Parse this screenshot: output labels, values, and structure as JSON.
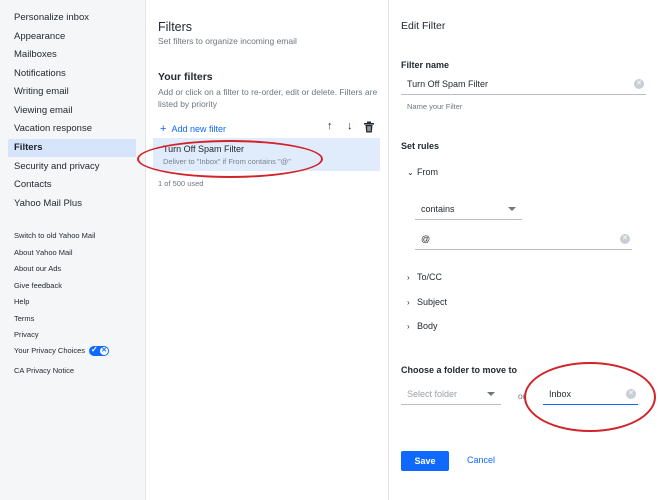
{
  "sidebar": {
    "items": [
      {
        "label": "Personalize inbox"
      },
      {
        "label": "Appearance"
      },
      {
        "label": "Mailboxes"
      },
      {
        "label": "Notifications"
      },
      {
        "label": "Writing email"
      },
      {
        "label": "Viewing email"
      },
      {
        "label": "Vacation response"
      },
      {
        "label": "Filters"
      },
      {
        "label": "Security and privacy"
      },
      {
        "label": "Contacts"
      },
      {
        "label": "Yahoo Mail Plus"
      }
    ],
    "active": "Filters",
    "footer": [
      {
        "label": "Switch to old Yahoo Mail"
      },
      {
        "label": "About Yahoo Mail"
      },
      {
        "label": "About our Ads"
      },
      {
        "label": "Give feedback"
      },
      {
        "label": "Help"
      },
      {
        "label": "Terms"
      },
      {
        "label": "Privacy"
      },
      {
        "label": "Your Privacy Choices"
      },
      {
        "label": "CA Privacy Notice"
      }
    ]
  },
  "filters_panel": {
    "title": "Filters",
    "subtitle": "Set filters to organize incoming email",
    "your_filters_heading": "Your filters",
    "your_filters_desc": "Add or click on a filter to re-order, edit or delete. Filters are listed by priority",
    "add_new_label": "Add new filter",
    "filter": {
      "name": "Turn Off Spam Filter",
      "description": "Deliver to \"Inbox\" if From contains \"@\""
    },
    "count_text": "1 of 500 used"
  },
  "edit_filter": {
    "title": "Edit Filter",
    "filter_name_label": "Filter name",
    "filter_name_value": "Turn Off Spam Filter",
    "filter_name_helper": "Name your Filter",
    "set_rules_label": "Set rules",
    "from_label": "From",
    "condition_value": "contains",
    "from_value": "@",
    "other_rules": [
      {
        "label": "To/CC"
      },
      {
        "label": "Subject"
      },
      {
        "label": "Body"
      }
    ],
    "folder_label": "Choose a folder to move to",
    "folder_placeholder": "Select folder",
    "or_text": "or",
    "new_folder_value": "Inbox",
    "save_label": "Save",
    "cancel_label": "Cancel"
  },
  "colors": {
    "accent": "#0f69ff",
    "annotation": "#d2232a"
  }
}
